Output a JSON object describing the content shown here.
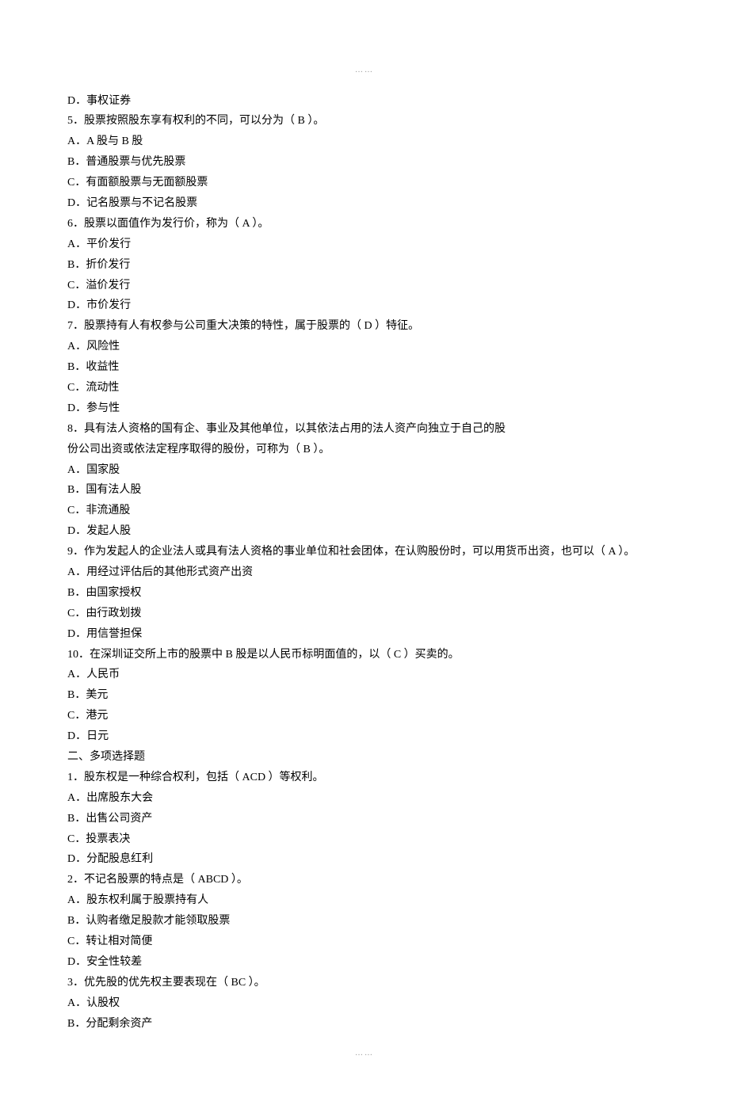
{
  "separator_top": "……",
  "separator_bottom": "……",
  "lines": [
    "D．事权证券",
    "5．股票按照股东享有权利的不同，可以分为（  B  ）。",
    "A．A 股与 B 股",
    "B．普通股票与优先股票",
    "C．有面额股票与无面额股票",
    "D．记名股票与不记名股票",
    "6．股票以面值作为发行价，称为（  A  ）。",
    "A．平价发行",
    "B．折价发行",
    "C．溢价发行",
    "D．市价发行",
    "7．股票持有人有权参与公司重大决策的特性，属于股票的（  D  ）特征。",
    "A．风险性",
    "B．收益性",
    "C．流动性",
    "D．参与性",
    "8．具有法人资格的国有企、事业及其他单位，以其依法占用的法人资产向独立于自己的股",
    "份公司出资或依法定程序取得的股份，可称为（  B  ）。",
    "A．国家股",
    "B．国有法人股",
    "C．非流通股",
    "D．发起人股",
    "9．作为发起人的企业法人或具有法人资格的事业单位和社会团体，在认购股份时，可以用货币出资，也可以（  A  ）。",
    "A．用经过评估后的其他形式资产出资",
    "B．由国家授权",
    "C．由行政划拨",
    "D．用信誉担保",
    "10．在深圳证交所上市的股票中 B 股是以人民币标明面值的，以（  C  ）买卖的。",
    "A．人民币",
    "B．美元",
    "C．港元",
    "D．日元",
    "二、多项选择题",
    "1．股东权是一种综合权利，包括（  ACD  ）等权利。",
    "A．出席股东大会",
    "B．出售公司资产",
    "C．投票表决",
    "D．分配股息红利",
    "2．不记名股票的特点是（  ABCD  ）。",
    "A．股东权利属于股票持有人",
    "B．认购者缴足股款才能领取股票",
    "C．转让相对简便",
    "D．安全性较差",
    "3．优先股的优先权主要表现在（  BC  ）。",
    "A．认股权",
    "B．分配剩余资产"
  ]
}
